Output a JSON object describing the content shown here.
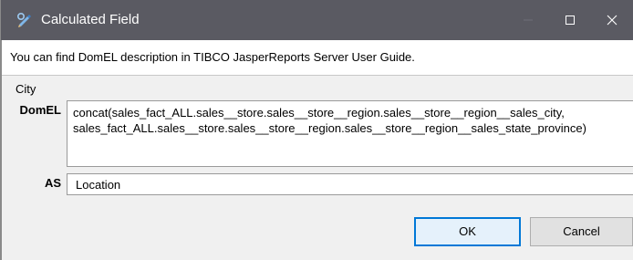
{
  "window": {
    "title": "Calculated Field",
    "icon": "pencil-tool-icon",
    "controls": [
      "minimize-icon",
      "maximize-icon",
      "close-icon"
    ]
  },
  "description": "You can find DomEL description in TIBCO JasperReports Server User Guide.",
  "field": {
    "name": "City",
    "domel_label": "DomEL",
    "domel_value": "concat(sales_fact_ALL.sales__store.sales__store__region.sales__store__region__sales_city,\nsales_fact_ALL.sales__store.sales__store__region.sales__store__region__sales_state_province)",
    "as_label": "AS",
    "as_value": "Location"
  },
  "buttons": {
    "ok_label": "OK",
    "cancel_label": "Cancel"
  },
  "colors": {
    "titlebar": "#5a5a62",
    "accent": "#0078d7",
    "background": "#f0f0f0"
  }
}
